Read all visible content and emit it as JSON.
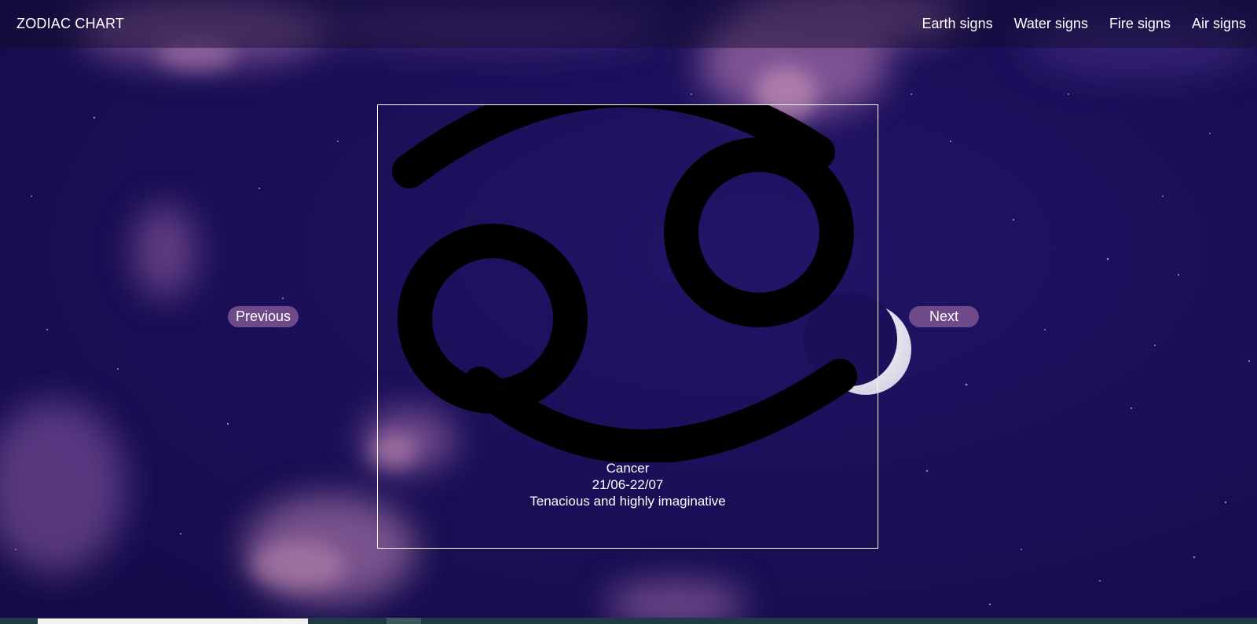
{
  "header": {
    "brand": "ZODIAC CHART",
    "nav": [
      "Earth signs",
      "Water signs",
      "Fire signs",
      "Air signs"
    ]
  },
  "carousel": {
    "previous_label": "Previous",
    "next_label": "Next"
  },
  "sign": {
    "name": "Cancer",
    "dates": "21/06-22/07",
    "trait": "Tenacious and highly imaginative",
    "symbol_icon": "cancer-zodiac-icon"
  },
  "colors": {
    "background": "#1a0f58",
    "pill": "#6f4a88",
    "symbol": "#000000",
    "text": "#ffffff"
  }
}
